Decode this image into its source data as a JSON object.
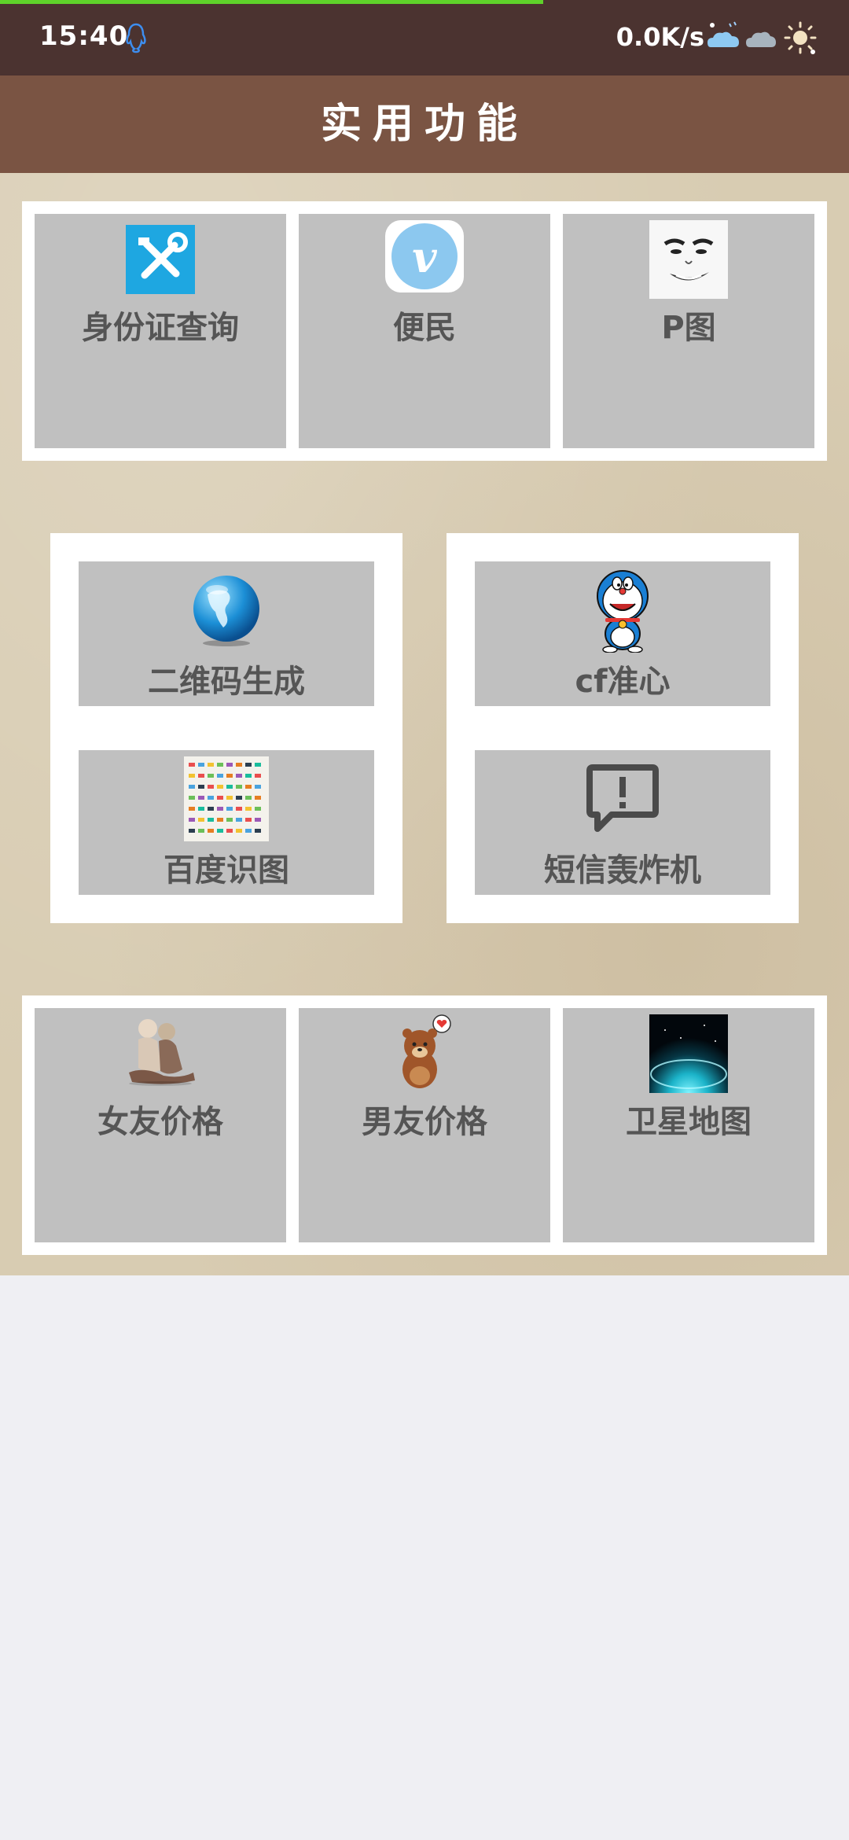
{
  "status_bar": {
    "time": "15:40",
    "net_speed": "0.0K/s",
    "load_progress": 0.64
  },
  "header": {
    "title": "实用功能"
  },
  "top_grid": [
    {
      "label": "身份证查询",
      "icon": "tools-icon"
    },
    {
      "label": "便民",
      "icon": "vimeo-v-icon"
    },
    {
      "label": "P图",
      "icon": "meme-face-icon"
    }
  ],
  "middle_left": [
    {
      "label": "二维码生成",
      "icon": "globe-icon"
    },
    {
      "label": "百度识图",
      "icon": "mosaic-thumbnail-icon"
    }
  ],
  "middle_right": [
    {
      "label": "cf准心",
      "icon": "doraemon-icon"
    },
    {
      "label": "短信轰炸机",
      "icon": "alert-message-icon"
    }
  ],
  "bottom_grid": [
    {
      "label": "女友价格",
      "icon": "couple-illustration-icon"
    },
    {
      "label": "男友价格",
      "icon": "bear-heart-icon"
    },
    {
      "label": "卫星地图",
      "icon": "earth-night-icon"
    }
  ],
  "colors": {
    "status_bg": "#4b3330",
    "header_bg": "#7a5443",
    "paper_bg": "#d8ccb2",
    "tile_bg": "#c0c0c0",
    "progress": "#5fd22a"
  }
}
